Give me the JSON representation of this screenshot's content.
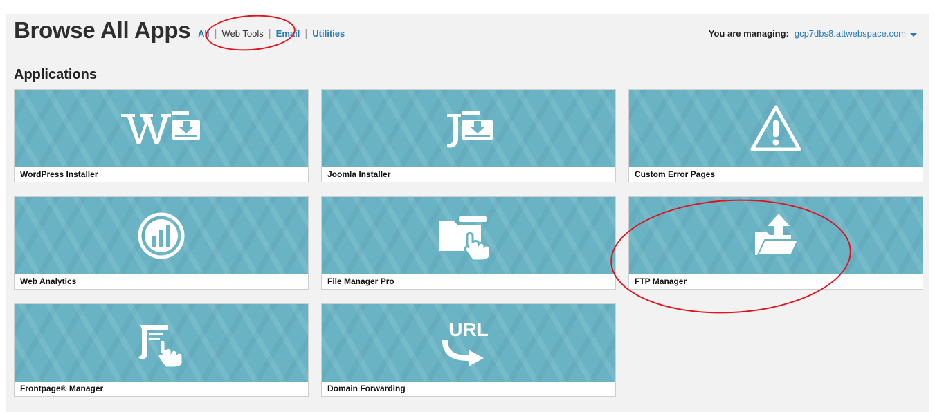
{
  "header": {
    "title": "Browse All Apps",
    "nav": [
      {
        "label": "All"
      },
      {
        "label": "Web Tools"
      },
      {
        "label": "Email"
      },
      {
        "label": "Utilities"
      }
    ],
    "managing_label": "You are managing:",
    "managing_domain": "gcp7dbs8.attwebspace.com"
  },
  "section_title": "Applications",
  "apps": [
    {
      "label": "WordPress Installer",
      "icon": "wordpress-installer-icon"
    },
    {
      "label": "Joomla Installer",
      "icon": "joomla-installer-icon"
    },
    {
      "label": "Custom Error Pages",
      "icon": "warning-icon"
    },
    {
      "label": "Web Analytics",
      "icon": "analytics-chart-icon"
    },
    {
      "label": "File Manager Pro",
      "icon": "folder-hand-icon"
    },
    {
      "label": "FTP Manager",
      "icon": "folder-upload-icon"
    },
    {
      "label": "Frontpage® Manager",
      "icon": "page-hand-icon"
    },
    {
      "label": "Domain Forwarding",
      "icon": "url-arrow-icon"
    }
  ],
  "icon_text": {
    "url": "URL"
  },
  "colors": {
    "tile": "#6ab3c4",
    "link": "#2a7ab8",
    "annotation": "#e0141e"
  }
}
